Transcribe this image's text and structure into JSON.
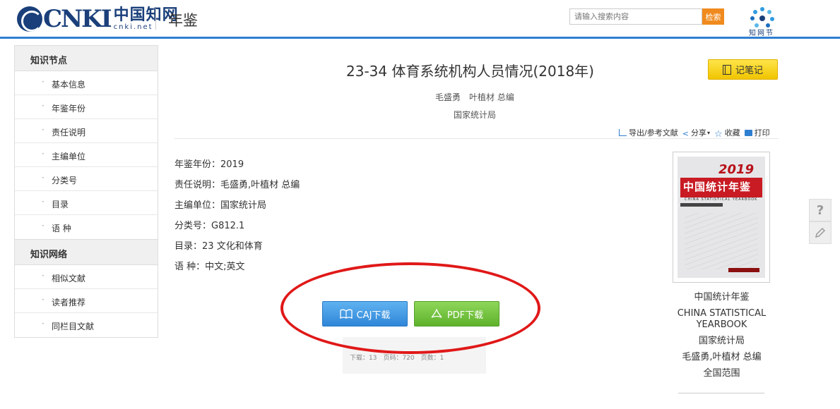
{
  "header": {
    "logo_text": "CNKI",
    "logo_cn": "中国知网",
    "logo_domain": "cnki.net",
    "section_title": "年鉴",
    "search_placeholder": "请输入搜索内容",
    "search_button": "检索",
    "zhiwangjie_text": "知网节"
  },
  "sidebar": {
    "groups": [
      {
        "title": "知识节点",
        "items": [
          "基本信息",
          "年鉴年份",
          "责任说明",
          "主编单位",
          "分类号",
          "目录",
          "语 种"
        ]
      },
      {
        "title": "知识网络",
        "items": [
          "相似文献",
          "读者推荐",
          "同栏目文献"
        ]
      }
    ]
  },
  "article": {
    "title": "23-34 体育系统机构人员情况(2018年)",
    "editors": "毛盛勇　叶植材 总编",
    "publisher": "国家统计局",
    "note_button": "记笔记"
  },
  "toolbar": {
    "export": "导出/参考文献",
    "share": "分享",
    "favorite": "收藏",
    "print": "打印"
  },
  "meta": [
    {
      "label": "年鉴年份：",
      "value": "2019"
    },
    {
      "label": "责任说明：",
      "value": "毛盛勇,叶植材 总编"
    },
    {
      "label": "主编单位：",
      "value": "国家统计局"
    },
    {
      "label": "分类号：",
      "value": "G812.1"
    },
    {
      "label": "目录：",
      "value": "23 文化和体育"
    },
    {
      "label": "语 种：",
      "value": "中文;英文"
    }
  ],
  "downloads": {
    "caj_label": "CAJ下载",
    "pdf_label": "PDF下载",
    "stats": "下载：13　页码：720　页数：1"
  },
  "book": {
    "cover_year": "2019",
    "cover_title": "中国统计年鉴",
    "cover_subtitle": "CHINA STATISTICAL YEARBOOK",
    "name_cn": "中国统计年鉴",
    "name_en": "CHINA STATISTICAL YEARBOOK",
    "publisher": "国家统计局",
    "editors": "毛盛勇,叶植材 总编",
    "scope": "全国范围"
  },
  "colors": {
    "accent_blue": "#2f7fd0",
    "search_orange": "#f08a1e",
    "note_yellow": "#f5cc00",
    "caj_blue": "#3a8ee0",
    "pdf_green": "#6cbf34",
    "annotation_red": "#e01818"
  }
}
